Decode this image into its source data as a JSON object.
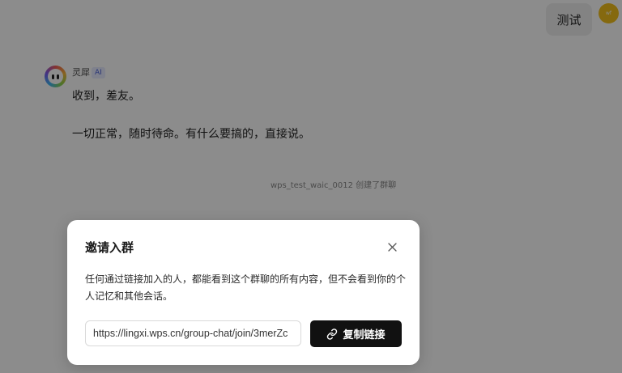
{
  "chat": {
    "user_message": "测试",
    "user_avatar_text": "wf",
    "bot": {
      "name": "灵犀",
      "badge": "AI",
      "messages": [
        "收到，差友。",
        "一切正常，随时待命。有什么要搞的，直接说。"
      ]
    },
    "system_note": "wps_test_waic_0012 创建了群聊"
  },
  "dialog": {
    "title": "邀请入群",
    "description": "任何通过链接加入的人，都能看到这个群聊的所有内容，但不会看到你的个人记忆和其他会话。",
    "link_value": "https://lingxi.wps.cn/group-chat/join/3merZc",
    "copy_button_label": "复制链接",
    "close_icon": "close-icon",
    "link_icon": "link-icon"
  },
  "colors": {
    "overlay": "#000000",
    "primary_button": "#111111",
    "user_avatar": "#f2bf1d",
    "ai_badge_text": "#4b62d8",
    "ai_badge_bg": "#e7ebff"
  }
}
